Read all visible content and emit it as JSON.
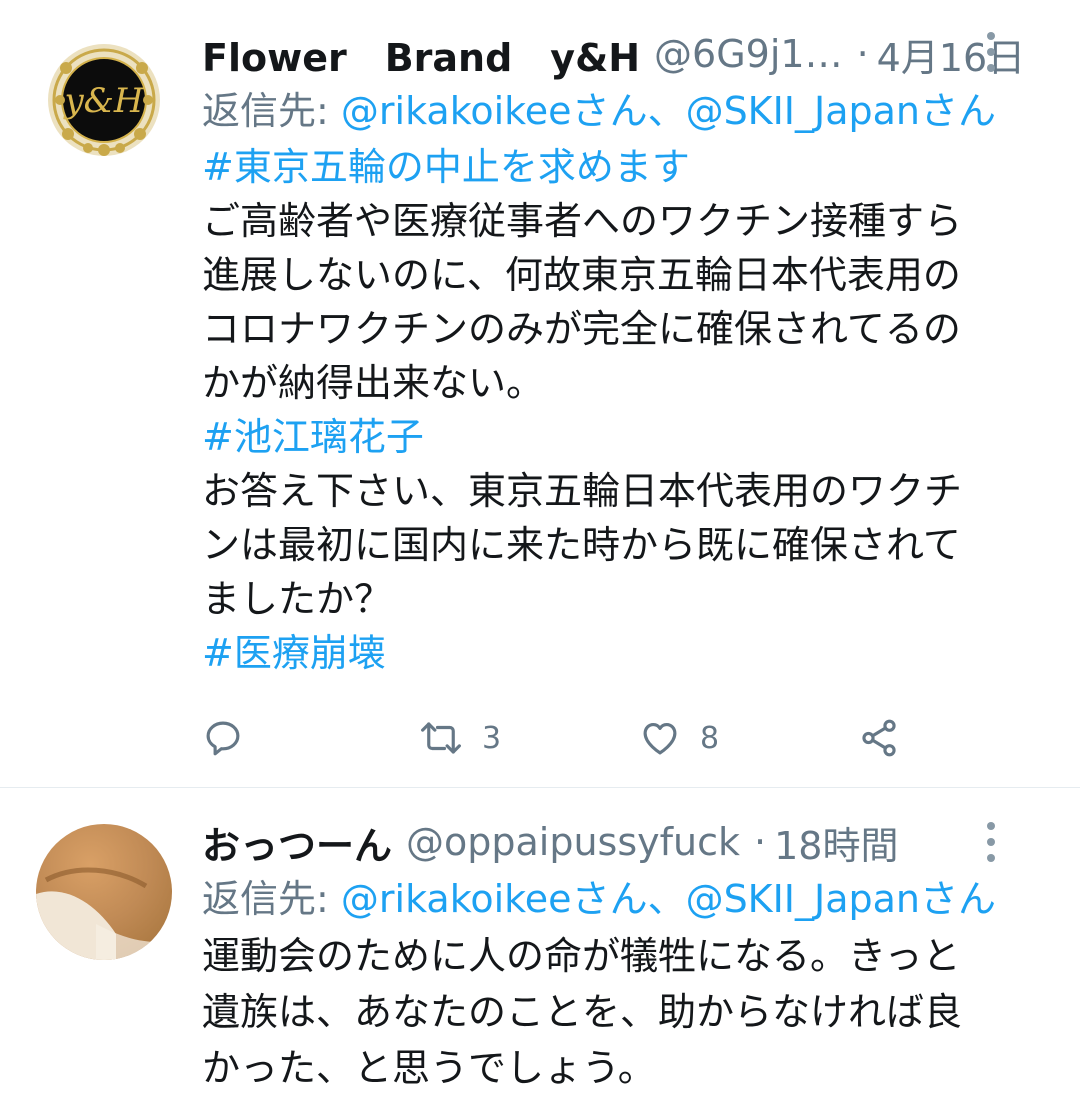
{
  "tweets": [
    {
      "display_name": "Flower　Brand　y&H",
      "handle": "@6G9j1…",
      "separator": "·",
      "time": "4月16日",
      "reply_prefix": "返信先: ",
      "reply_to": "@rikakoikeeさん、@SKII_Japanさん",
      "lines": [
        {
          "text": "#東京五輪の中止を求めます",
          "hashtag": true
        },
        {
          "text": "ご高齢者や医療従事者へのワクチン接種すら",
          "hashtag": false
        },
        {
          "text": "進展しないのに、何故東京五輪日本代表用の",
          "hashtag": false
        },
        {
          "text": "コロナワクチンのみが完全に確保されてるの",
          "hashtag": false
        },
        {
          "text": "かが納得出来ない。",
          "hashtag": false
        },
        {
          "text": "#池江璃花子",
          "hashtag": true
        },
        {
          "text": "お答え下さい、東京五輪日本代表用のワクチ",
          "hashtag": false
        },
        {
          "text": "ンは最初に国内に来た時から既に確保されて",
          "hashtag": false
        },
        {
          "text": "ましたか？",
          "hashtag": false
        },
        {
          "text": "#医療崩壊",
          "hashtag": true
        }
      ],
      "actions": {
        "reply_icon": "reply-icon",
        "retweet_icon": "retweet-icon",
        "retweet_count": "3",
        "like_icon": "heart-icon",
        "like_count": "8",
        "share_icon": "share-icon"
      }
    },
    {
      "display_name": "おっつーん",
      "handle": "@oppaipussyfuck",
      "separator": "·",
      "time": "18時間",
      "reply_prefix": "返信先: ",
      "reply_to": "@rikakoikeeさん、@SKII_Japanさん",
      "lines": [
        {
          "text": "運動会のために人の命が犠牲になる。きっと",
          "hashtag": false
        },
        {
          "text": "遺族は、あなたのことを、助からなければ良",
          "hashtag": false
        },
        {
          "text": "かった、と思うでしょう。",
          "hashtag": false
        }
      ]
    }
  ],
  "colors": {
    "link": "#1da1f2",
    "secondary": "#657786",
    "text": "#14171a",
    "divider": "#e6ecf0"
  }
}
